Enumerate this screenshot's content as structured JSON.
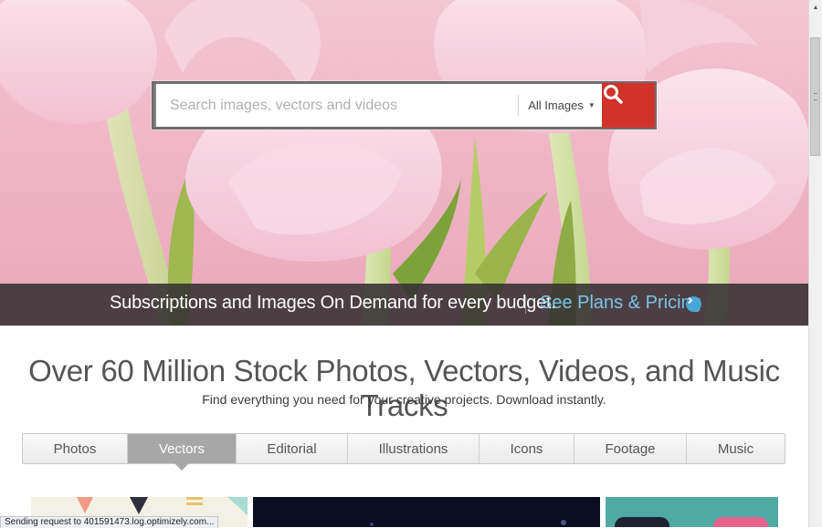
{
  "search": {
    "placeholder": "Search images, vectors and videos",
    "scope_label": "All Images",
    "button_icon": "search-icon"
  },
  "promo": {
    "text": "Subscriptions and Images On Demand for every budget.",
    "link": "See Plans & Pricing",
    "link_icon": "chevron-right-icon"
  },
  "headline": "Over 60 Million Stock Photos, Vectors, Videos, and Music Tracks",
  "subheadline": "Find everything you need for your creative projects. Download instantly.",
  "tabs": [
    {
      "label": "Photos",
      "active": false
    },
    {
      "label": "Vectors",
      "active": true
    },
    {
      "label": "Editorial",
      "active": false
    },
    {
      "label": "Illustrations",
      "active": false
    },
    {
      "label": "Icons",
      "active": false
    },
    {
      "label": "Footage",
      "active": false
    },
    {
      "label": "Music",
      "active": false
    }
  ],
  "status_bar": "Sending request to 401591473.log.optimizely.com...",
  "colors": {
    "search_button": "#d0332a",
    "promo_link": "#7fc3e6",
    "active_tab": "#a7a7a7"
  }
}
